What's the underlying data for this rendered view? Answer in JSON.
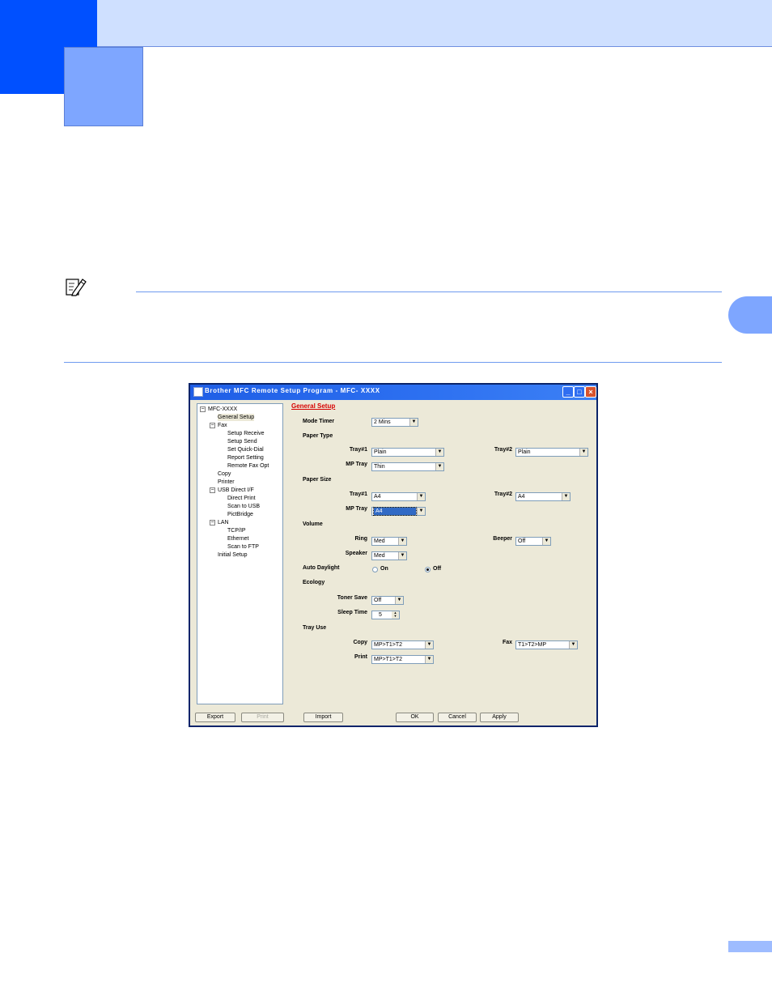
{
  "window": {
    "title": "Brother MFC Remote Setup Program - MFC- XXXX",
    "controls": {
      "minimize": "_",
      "maximize": "□",
      "close": "×"
    }
  },
  "tree": {
    "root": {
      "label": "MFC-XXXX",
      "toggle": "−"
    },
    "items": [
      {
        "label": "General Setup",
        "selected": true
      },
      {
        "label": "Fax",
        "toggle": "−"
      },
      {
        "label": "Setup Receive"
      },
      {
        "label": "Setup Send"
      },
      {
        "label": "Set Quick-Dial"
      },
      {
        "label": "Report Setting"
      },
      {
        "label": "Remote Fax Opt"
      },
      {
        "label": "Copy"
      },
      {
        "label": "Printer"
      },
      {
        "label": "USB Direct I/F",
        "toggle": "−"
      },
      {
        "label": "Direct Print"
      },
      {
        "label": "Scan to USB"
      },
      {
        "label": "PictBridge"
      },
      {
        "label": "LAN",
        "toggle": "−"
      },
      {
        "label": "TCP/IP"
      },
      {
        "label": "Ethernet"
      },
      {
        "label": "Scan to FTP"
      },
      {
        "label": "Initial Setup"
      }
    ]
  },
  "panel": {
    "heading": "General Setup",
    "mode_timer": {
      "label": "Mode Timer",
      "value": "2 Mins"
    },
    "paper_type": {
      "title": "Paper Type",
      "tray1": {
        "label": "Tray#1",
        "value": "Plain"
      },
      "tray2": {
        "label": "Tray#2",
        "value": "Plain"
      },
      "mp_tray": {
        "label": "MP Tray",
        "value": "Thin"
      }
    },
    "paper_size": {
      "title": "Paper Size",
      "tray1": {
        "label": "Tray#1",
        "value": "A4"
      },
      "tray2": {
        "label": "Tray#2",
        "value": "A4"
      },
      "mp_tray": {
        "label": "MP Tray",
        "value": "A4"
      }
    },
    "volume": {
      "title": "Volume",
      "ring": {
        "label": "Ring",
        "value": "Med"
      },
      "beeper": {
        "label": "Beeper",
        "value": "Off"
      },
      "speaker": {
        "label": "Speaker",
        "value": "Med"
      }
    },
    "auto_daylight": {
      "label": "Auto Daylight",
      "on": "On",
      "off": "Off",
      "selected": "Off"
    },
    "ecology": {
      "title": "Ecology",
      "toner_save": {
        "label": "Toner Save",
        "value": "Off"
      },
      "sleep_time": {
        "label": "Sleep Time",
        "value": "5"
      }
    },
    "tray_use": {
      "title": "Tray Use",
      "copy": {
        "label": "Copy",
        "value": "MP>T1>T2"
      },
      "fax": {
        "label": "Fax",
        "value": "T1>T2>MP"
      },
      "print": {
        "label": "Print",
        "value": "MP>T1>T2"
      }
    }
  },
  "buttons": {
    "export": "Export",
    "print": "Print",
    "import": "Import",
    "ok": "OK",
    "cancel": "Cancel",
    "apply": "Apply"
  },
  "colors": {
    "header_dark": "#0050ff",
    "header_light": "#7ea6ff",
    "header_band": "#cfe0ff",
    "heading_red": "#d60000",
    "titlebar": "#2c6ff0",
    "close_button": "#d8532d"
  },
  "icons": {
    "note": "note-pencil-icon",
    "app": "printer-app-icon",
    "dropdown": "chevron-down-icon"
  }
}
